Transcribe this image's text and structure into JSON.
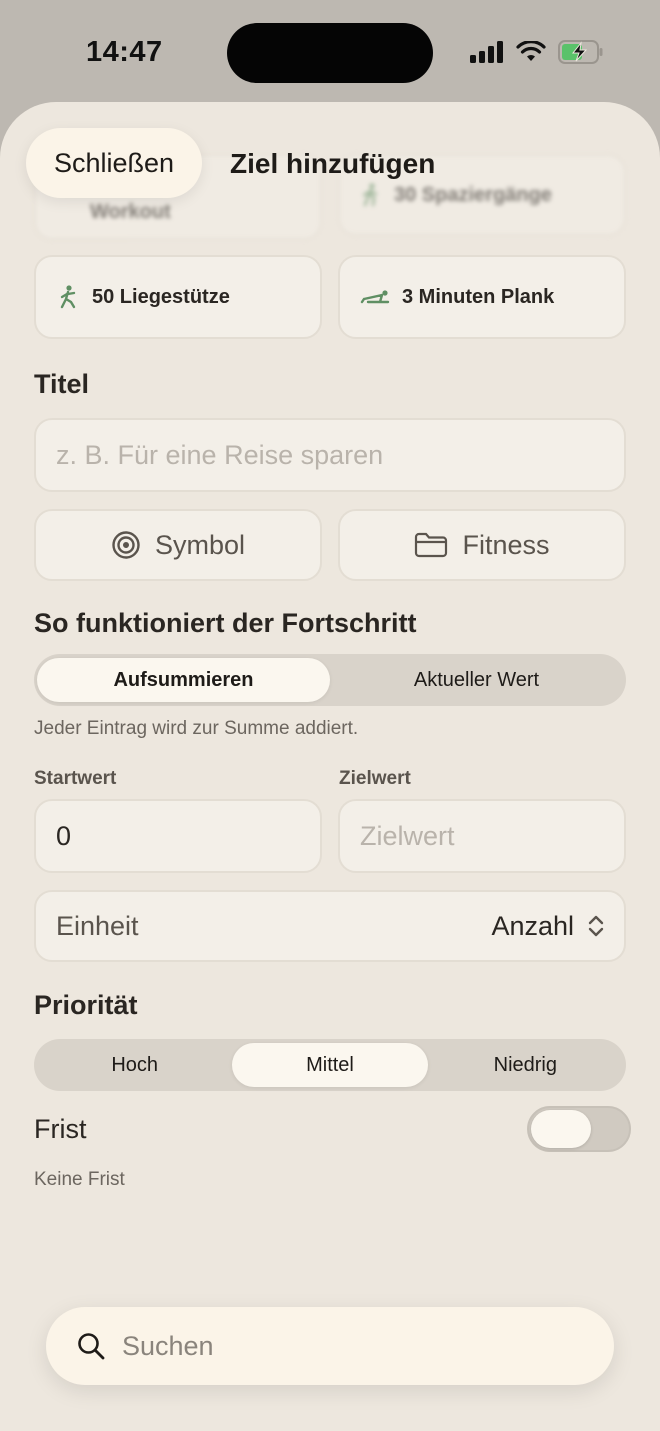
{
  "status": {
    "time": "14:47"
  },
  "header": {
    "close_label": "Schließen",
    "title": "Ziel hinzufügen"
  },
  "templates": [
    {
      "label_line1": "Workout",
      "partial": true,
      "icon": "run-icon"
    },
    {
      "label": "30 Spaziergänge",
      "partial": true,
      "icon": "walk-icon"
    },
    {
      "label": "50 Liegestütze",
      "icon": "pushup-icon"
    },
    {
      "label": "3 Minuten Plank",
      "icon": "plank-icon"
    }
  ],
  "title_section": {
    "label": "Titel",
    "placeholder": "z. B. Für eine Reise sparen"
  },
  "options": {
    "symbol_label": "Symbol",
    "category_label": "Fitness"
  },
  "progress": {
    "label": "So funktioniert der Fortschritt",
    "segments": [
      "Aufsummieren",
      "Aktueller Wert"
    ],
    "selected": "Aufsummieren",
    "hint": "Jeder Eintrag wird zur Summe addiert."
  },
  "values": {
    "start_label": "Startwert",
    "start_value": "0",
    "target_label": "Zielwert",
    "target_placeholder": "Zielwert"
  },
  "unit": {
    "label": "Einheit",
    "value": "Anzahl"
  },
  "priority": {
    "label": "Priorität",
    "segments": [
      "Hoch",
      "Mittel",
      "Niedrig"
    ],
    "selected": "Mittel"
  },
  "deadline": {
    "label": "Frist",
    "enabled": false,
    "hint": "Keine Frist"
  },
  "search": {
    "placeholder": "Suchen"
  },
  "colors": {
    "accent_green": "#5f8f63",
    "sheet_bg": "#ede7de"
  }
}
